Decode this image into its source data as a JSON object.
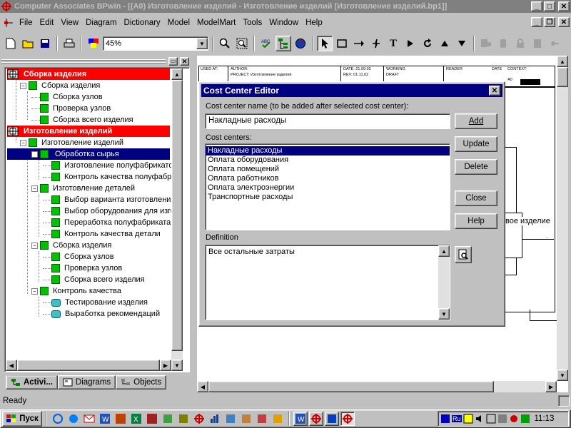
{
  "window": {
    "title": "Computer Associates BPwin - [(A0) Изготовление изделий - Изготовление изделий  [Изготовление изделий.bp1]]",
    "min": "_",
    "max": "□",
    "close": "✕",
    "doc_min": "_",
    "doc_restore": "❐",
    "doc_close": "✕"
  },
  "menu": [
    "File",
    "Edit",
    "View",
    "Diagram",
    "Dictionary",
    "Model",
    "ModelMart",
    "Tools",
    "Window",
    "Help"
  ],
  "toolbar": {
    "zoom": "45%"
  },
  "tree": {
    "nodes": [
      {
        "label": "Сборка изделия",
        "style": "red",
        "icon": "activity-root-icon"
      },
      {
        "label": "Сборка изделия",
        "style": "normal",
        "icon": "green-box"
      },
      {
        "label": "Сборка узлов",
        "style": "normal",
        "icon": "green-box"
      },
      {
        "label": "Проверка узлов",
        "style": "normal",
        "icon": "green-box"
      },
      {
        "label": "Сборка всего изделия",
        "style": "normal",
        "icon": "green-box"
      },
      {
        "label": "Изготовление изделий",
        "style": "red",
        "icon": "activity-root-icon"
      },
      {
        "label": "Изготовление изделий",
        "style": "normal",
        "icon": "green-box"
      },
      {
        "label": "Обработка  сырья",
        "style": "selected",
        "icon": "green-box"
      },
      {
        "label": "Изготовление полуфабрикатов",
        "style": "normal",
        "icon": "green-box"
      },
      {
        "label": "Контроль качества полуфабрикатов",
        "style": "normal",
        "icon": "green-box"
      },
      {
        "label": "Изготовление  деталей",
        "style": "normal",
        "icon": "green-box"
      },
      {
        "label": "Выбор  варианта изготовления",
        "style": "normal",
        "icon": "green-box"
      },
      {
        "label": "Выбор оборудования для изготовления",
        "style": "normal",
        "icon": "green-box"
      },
      {
        "label": "Переработка полуфабриката",
        "style": "normal",
        "icon": "green-box"
      },
      {
        "label": "Контроль качества детали",
        "style": "normal",
        "icon": "green-box"
      },
      {
        "label": "Сборка изделия",
        "style": "normal",
        "icon": "green-box"
      },
      {
        "label": "Сборка узлов",
        "style": "normal",
        "icon": "green-box"
      },
      {
        "label": "Проверка узлов",
        "style": "normal",
        "icon": "green-box"
      },
      {
        "label": "Сборка всего изделия",
        "style": "normal",
        "icon": "green-box"
      },
      {
        "label": "Контроль качества",
        "style": "normal",
        "icon": "green-box"
      },
      {
        "label": "Тестирование изделия",
        "style": "normal",
        "icon": "cyan-box"
      },
      {
        "label": "Выработка рекомендаций",
        "style": "normal",
        "icon": "cyan-box"
      }
    ]
  },
  "tabs": [
    "Activi...",
    "Diagrams",
    "Objects"
  ],
  "diagram": {
    "used_at": "USED AT:",
    "author": "AUTHOR:",
    "project": "PROJECT:  Изготовление изделия",
    "date": "DATE: 21.09.02",
    "rev": "REV:  01.11.02",
    "working": "WORKING",
    "draft": "DRAFT",
    "reader": "READER",
    "date2": "DATE",
    "context": "CONTEXT:",
    "node_id": "A0",
    "label_visible": "вое изделие",
    "arrow_tail": "→"
  },
  "dialog": {
    "title": "Cost Center Editor",
    "name_label": "Cost center name (to be added after selected cost center):",
    "name_value": "Накладные расходы",
    "list_label": "Cost centers:",
    "items": [
      "Накладные расходы",
      "Оплата оборудования",
      "Оплата помещений",
      "Оплата работников",
      "Оплата электроэнергии",
      "Транспортные расходы"
    ],
    "selected_index": 0,
    "buttons": {
      "add": "Add",
      "update": "Update",
      "delete": "Delete",
      "close": "Close",
      "help": "Help"
    },
    "definition_label": "Definition",
    "definition_value": "Все остальные затраты"
  },
  "status": {
    "text": "Ready"
  },
  "taskbar": {
    "start": "Пуск",
    "clock": "11:13",
    "lang": "Ru"
  }
}
